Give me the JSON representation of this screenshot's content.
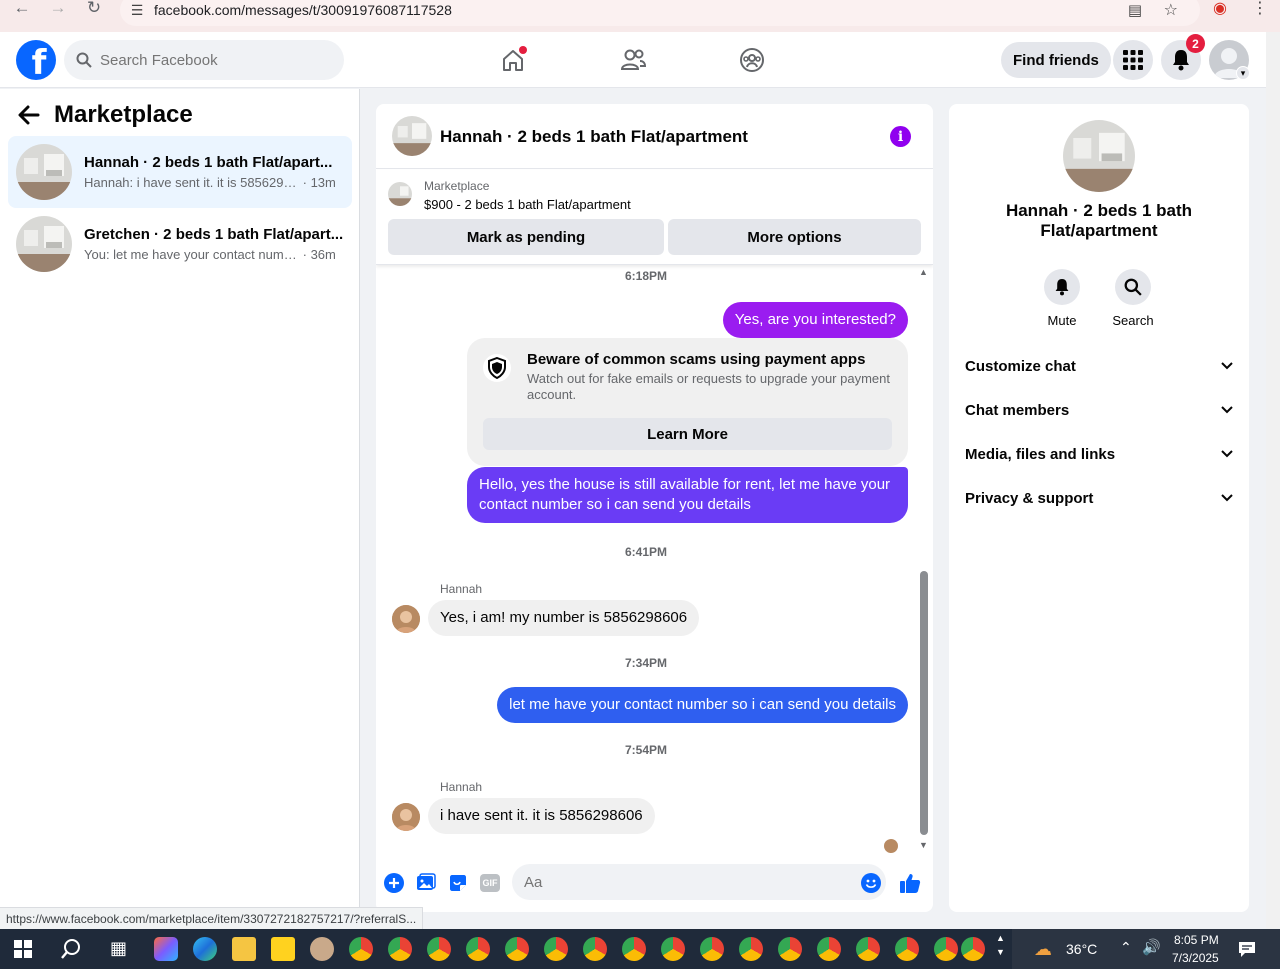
{
  "browser": {
    "url": "facebook.com/messages/t/30091976087117528",
    "status_url": "https://www.facebook.com/marketplace/item/3307272182757217/?referralS..."
  },
  "topnav": {
    "search_placeholder": "Search Facebook",
    "find_friends_label": "Find friends",
    "notification_count": "2"
  },
  "sidebar": {
    "title": "Marketplace",
    "conversations": [
      {
        "name": "Hannah · 2 beds 1 bath Flat/apart...",
        "preview": "Hannah: i have sent it. it is 5856298...",
        "time": "· 13m",
        "active": true
      },
      {
        "name": "Gretchen · 2 beds 1 bath Flat/apart...",
        "preview": "You: let me have your contact numb...",
        "time": "· 36m",
        "active": false
      }
    ]
  },
  "chat": {
    "title": "Hannah · 2 beds 1 bath Flat/apartment",
    "listing": {
      "source": "Marketplace",
      "price_title": "$900 - 2 beds 1 bath Flat/apartment",
      "mark_pending_label": "Mark as pending",
      "more_options_label": "More options"
    },
    "timestamps": [
      "6:18PM",
      "6:41PM",
      "7:34PM",
      "7:54PM"
    ],
    "messages": {
      "out1": "Yes, are you interested?",
      "out2": "Hello, yes the house is still available for rent, let me have your contact number so i can send you details",
      "in1_sender": "Hannah",
      "in1": "Yes, i am! my number is 5856298606",
      "out3": "let me have your contact number so i can send you details",
      "in2_sender": "Hannah",
      "in2": "i have sent it. it is 5856298606"
    },
    "scam_notice": {
      "title": "Beware of common scams using payment apps",
      "text": "Watch out for fake emails or requests to upgrade your payment account.",
      "button_label": "Learn More"
    },
    "composer_placeholder": "Aa",
    "bubble_colors": {
      "purple": "#9a1cf0",
      "violet": "#6a3cf5",
      "blue": "#2f5ff0"
    }
  },
  "details_panel": {
    "title": "Hannah · 2 beds 1 bath Flat/apartment",
    "actions": [
      {
        "label": "Mute",
        "icon": "bell-icon"
      },
      {
        "label": "Search",
        "icon": "search-icon"
      }
    ],
    "sections": [
      "Customize chat",
      "Chat members",
      "Media, files and links",
      "Privacy & support"
    ]
  },
  "taskbar": {
    "temperature": "36°C",
    "time": "8:05 PM",
    "date": "7/3/2025"
  },
  "colors": {
    "brand": "#0866ff",
    "accent": "#9000ef",
    "badge": "#e41e3f"
  }
}
